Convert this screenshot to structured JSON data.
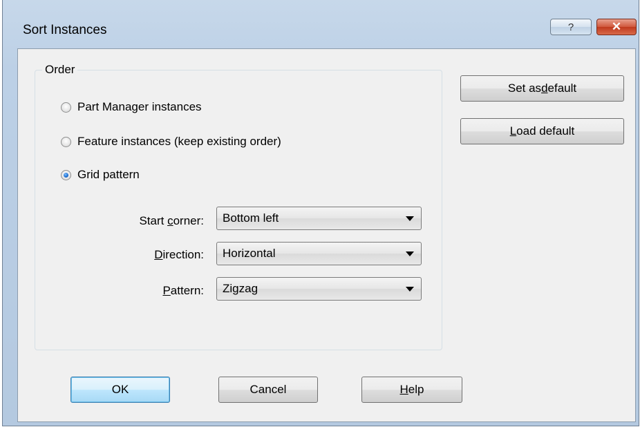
{
  "window": {
    "title": "Sort Instances",
    "help_button": "?",
    "close_button": "✕"
  },
  "order_group": {
    "legend": "Order",
    "options": [
      {
        "label": "Part Manager instances",
        "checked": false
      },
      {
        "label": "Feature instances (keep existing order)",
        "checked": false
      },
      {
        "label": "Grid pattern",
        "checked": true
      }
    ]
  },
  "grid_settings": {
    "start_corner": {
      "label_pre": "Start ",
      "label_u": "c",
      "label_post": "orner:",
      "value": "Bottom left"
    },
    "direction": {
      "label_pre": "",
      "label_u": "D",
      "label_post": "irection:",
      "value": "Horizontal"
    },
    "pattern": {
      "label_pre": "",
      "label_u": "P",
      "label_post": "attern:",
      "value": "Zigzag"
    }
  },
  "side_buttons": {
    "set_default": {
      "pre": "Set as ",
      "u": "d",
      "post": "efault"
    },
    "load_default": {
      "pre": "",
      "u": "L",
      "post": "oad default"
    }
  },
  "footer_buttons": {
    "ok": "OK",
    "cancel": "Cancel",
    "help": {
      "pre": "",
      "u": "H",
      "post": "elp"
    }
  }
}
